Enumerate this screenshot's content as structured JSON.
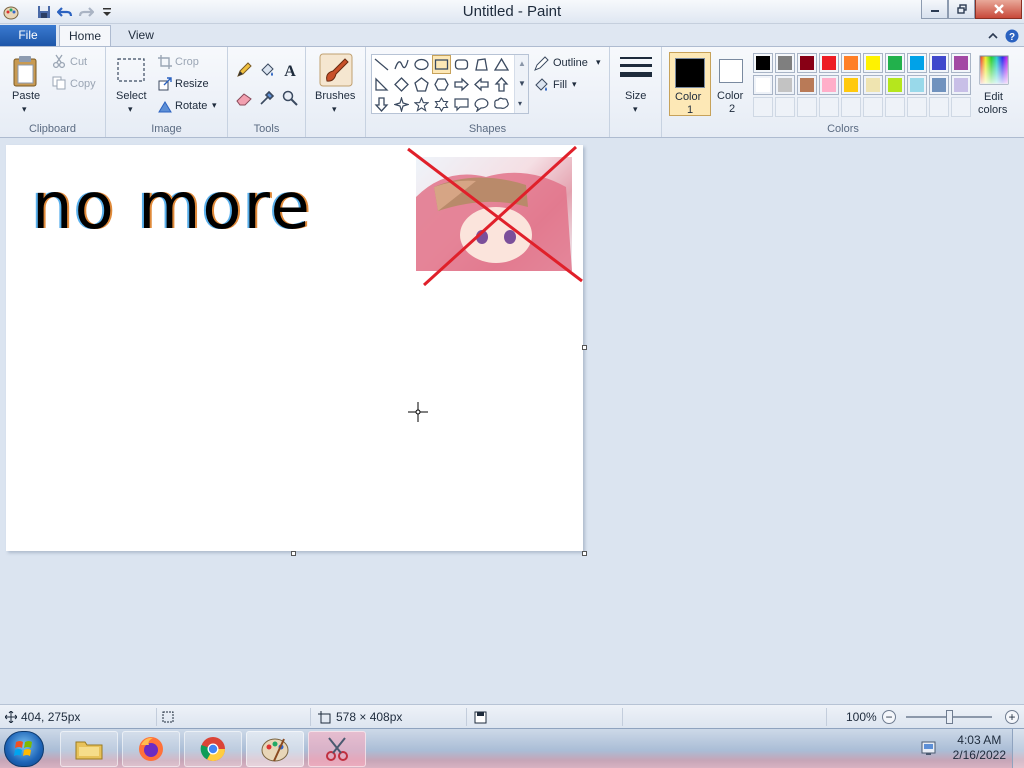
{
  "window": {
    "title": "Untitled - Paint",
    "buttons": [
      "minimize",
      "restore",
      "close"
    ]
  },
  "tabs": {
    "file": "File",
    "home": "Home",
    "view": "View"
  },
  "ribbon": {
    "clipboard": {
      "label": "Clipboard",
      "paste": "Paste",
      "cut": "Cut",
      "copy": "Copy"
    },
    "image": {
      "label": "Image",
      "select": "Select",
      "crop": "Crop",
      "resize": "Resize",
      "rotate": "Rotate"
    },
    "tools": {
      "label": "Tools"
    },
    "brushes": {
      "label": "Brushes"
    },
    "shapes": {
      "label": "Shapes",
      "outline": "Outline",
      "fill": "Fill"
    },
    "size": {
      "label": "Size"
    },
    "colors": {
      "label": "Colors",
      "color1_label": "Color",
      "color1_num": "1",
      "color2_label": "Color",
      "color2_num": "2",
      "edit_label_1": "Edit",
      "edit_label_2": "colors",
      "color1_value": "#000000",
      "color2_value": "#ffffff",
      "palette_row1": [
        "#000000",
        "#7f7f7f",
        "#880015",
        "#ed1c24",
        "#ff7f27",
        "#fff200",
        "#22b14c",
        "#00a2e8",
        "#3f48cc",
        "#a349a4"
      ],
      "palette_row2": [
        "#ffffff",
        "#c3c3c3",
        "#b97a57",
        "#ffaec9",
        "#ffc90e",
        "#efe4b0",
        "#b5e61d",
        "#99d9ea",
        "#7092be",
        "#c8bfe7"
      ],
      "palette_row3_empty": 10
    }
  },
  "canvas": {
    "drawn_text": "no more",
    "has_pasted_image": true,
    "pasted_image_crossed_out": true,
    "cross_color": "#e0202a"
  },
  "status": {
    "cursor_pos": "404, 275px",
    "canvas_size": "578 × 408px",
    "zoom": "100%",
    "zoom_fraction": 0.5
  },
  "taskbar": {
    "apps": [
      "file-explorer",
      "firefox",
      "chrome",
      "paint",
      "snipping-tool"
    ],
    "time": "4:03 AM",
    "date": "2/16/2022"
  }
}
